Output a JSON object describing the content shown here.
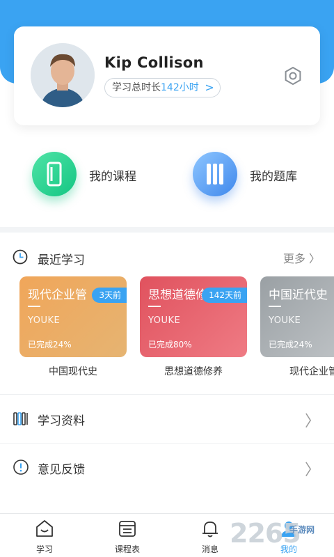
{
  "profile": {
    "name": "Kip Collison",
    "study_prefix": "学习总时长",
    "study_hours": "142小时",
    "chevron": ">"
  },
  "quick_actions": [
    {
      "label": "我的课程",
      "icon": "book-icon"
    },
    {
      "label": "我的题库",
      "icon": "books-icon"
    }
  ],
  "recent": {
    "title": "最近学习",
    "more": "更多"
  },
  "courses": [
    {
      "title": "现代企业管",
      "badge": "3天前",
      "brand": "YOUKE",
      "progress": "已完成24%",
      "name": "中国现代史"
    },
    {
      "title": "思想道德修养",
      "badge": "142天前",
      "brand": "YOUKE",
      "progress": "已完成80%",
      "name": "思想道德修养"
    },
    {
      "title": "中国近代史",
      "badge": "",
      "brand": "YOUKE",
      "progress": "已完成24%",
      "name": "现代企业管"
    }
  ],
  "list": [
    {
      "label": "学习资料",
      "icon": "bookshelf-icon"
    },
    {
      "label": "意见反馈",
      "icon": "info-circle-icon"
    }
  ],
  "tabs": [
    {
      "label": "学习",
      "icon": "home-icon"
    },
    {
      "label": "课程表",
      "icon": "calendar-icon"
    },
    {
      "label": "消息",
      "icon": "bell-icon"
    },
    {
      "label": "我的",
      "icon": "user-icon",
      "active": true
    }
  ],
  "watermark": {
    "number": "2265",
    "text": "手游网"
  },
  "colors": {
    "accent": "#3aa3f2",
    "green": "#14c683",
    "blue": "#3f88ec",
    "orange": "#f0a65a",
    "red": "#e0525e",
    "gray": "#9aa0a4"
  }
}
